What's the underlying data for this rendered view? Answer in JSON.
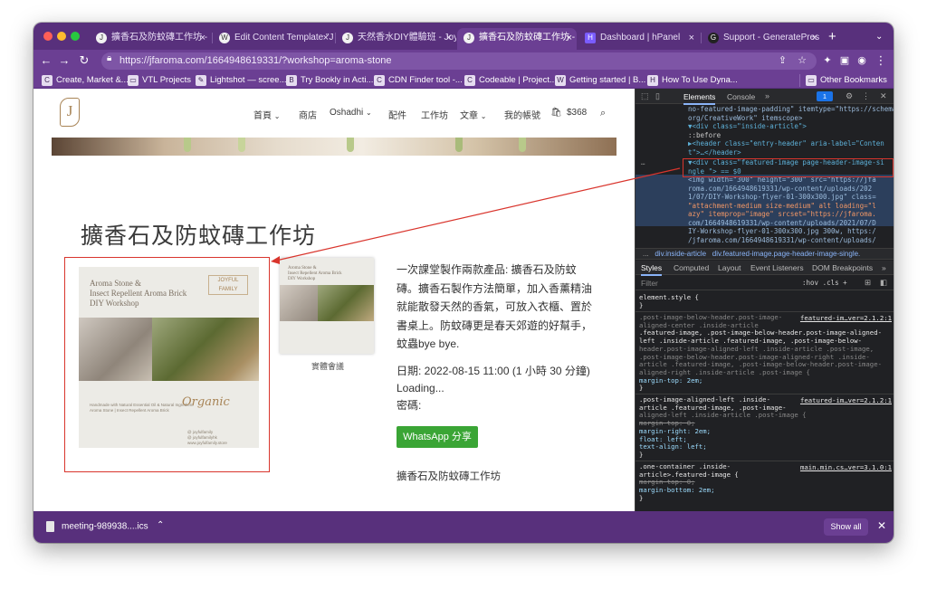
{
  "browser": {
    "tabs": [
      {
        "title": "擴香石及防蚊磚工作坊 - J",
        "icon": "joyful-icon",
        "active": false
      },
      {
        "title": "Edit Content Template \"J",
        "icon": "wordpress-icon",
        "active": false
      },
      {
        "title": "天然香水DIY體驗班 - Joy",
        "icon": "joyful-icon",
        "active": false
      },
      {
        "title": "擴香石及防蚊磚工作坊 - J",
        "icon": "joyful-icon",
        "active": true
      },
      {
        "title": "Dashboard | hPanel",
        "icon": "hostinger-icon",
        "active": false
      },
      {
        "title": "Support - GeneratePres",
        "icon": "generatepress-icon",
        "active": false
      }
    ],
    "url": "https://jfaroma.com/1664948619331/?workshop=aroma-stone",
    "bookmarks": [
      "Create, Market &...",
      "VTL Projects",
      "Lightshot — scree...",
      "Try Bookly in Acti...",
      "CDN Finder tool -...",
      "Codeable | Project...",
      "Getting started | B...",
      "How To Use Dyna..."
    ],
    "other_bookmarks": "Other Bookmarks",
    "colors": {
      "frame": "#58307c",
      "toolbar": "#6b3f93"
    }
  },
  "site": {
    "nav": [
      "首頁",
      "商店",
      "Oshadhi",
      "配件",
      "工作坊",
      "文章",
      "我的帳號"
    ],
    "cart_amount": "$368",
    "title": "擴香石及防蚊磚工作坊",
    "poster_title": [
      "Aroma Stone &",
      "Insect Repellent Aroma Brick",
      "DIY Workshop"
    ],
    "poster_brand": [
      "JOYFUL",
      "FAMILY"
    ],
    "poster_organic": "Organic",
    "poster_small": [
      "Handmade with Natural Essential Oil & Natural Ingredient",
      "Aroma Stone | Insect Repellent Aroma Brick"
    ],
    "poster_social": [
      "@ joyfulfamily",
      "@ joyfulfamilyhk",
      "www.joyfulfamily.store"
    ],
    "thumb_title": [
      "Aroma Stone &",
      "Insect Repellent Aroma Brick",
      "DIY Workshop"
    ],
    "thumb_caption": "實體會議",
    "description": "一次課堂製作兩款產品: 擴香石及防蚊磚。擴香石製作方法簡單，加入香薰精油就能散發天然的香氣，可放入衣櫃、置於書桌上。防蚊磚更是春天郊遊的好幫手，蚊蟲bye bye.",
    "date_line": "日期: 2022-08-15 11:00 (1 小時 30 分鐘)",
    "loading": "Loading...",
    "password": "密碼:",
    "whatsapp_label": "WhatsApp 分享",
    "footer_title": "擴香石及防蚊磚工作坊",
    "whatsapp_color": "#3aa535",
    "annotation_color": "#d9352d"
  },
  "devtools": {
    "tabs": [
      "Elements",
      "Console"
    ],
    "badge": "1",
    "code_lines": [
      "no-featured-image-padding\" itemtype=\"https://schema.",
      "org/CreativeWork\" itemscope>",
      "▼<div class=\"inside-article\">",
      "  ::before",
      "  ▶<header class=\"entry-header\" aria-label=\"Conten",
      "  t\">…</header>",
      "  ▼<div class=\"featured-image  page-header-image-si",
      "  ngle \"> == $0",
      "    <img width=\"300\" height=\"300\" src=\"https://jfa",
      "    roma.com/1664948619331/wp-content/uploads/202",
      "    1/07/DIY-Workshop-flyer-01-300x300.jpg\" class=",
      "    \"attachment-medium size-medium\" alt loading=\"l",
      "    azy\" itemprop=\"image\" srcset=\"https://jfaroma.",
      "    com/1664948619331/wp-content/uploads/2021/07/D",
      "    IY-Workshop-flyer-01-300x300.jpg 300w, https:/",
      "    /jfaroma.com/1664948619331/wp-content/uploads/"
    ],
    "breadcrumbs": [
      "...",
      "div.inside-article",
      "div.featured-image.page-header-image-single."
    ],
    "style_tabs": [
      "Styles",
      "Computed",
      "Layout",
      "Event Listeners",
      "DOM Breakpoints"
    ],
    "filter_placeholder": "Filter",
    "filter_tools": ":hov  .cls  +",
    "styles": [
      {
        "lines": [
          "element.style {",
          "}"
        ],
        "link": ""
      },
      {
        "lines": [
          ".post-image-below-header.post-image-",
          "aligned-center .inside-article",
          ".featured-image, .post-image-below-header.post-image-aligned-",
          "left .inside-article .featured-image, .post-image-below-",
          "header.post-image-aligned-left .inside-article .post-image,",
          ".post-image-below-header.post-image-aligned-right .inside-",
          "article .featured-image, .post-image-below-header.post-image-",
          "aligned-right .inside-article .post-image {",
          "  margin-top: 2em;",
          "}"
        ],
        "link": "featured-im…ver=2.1.2:1"
      },
      {
        "lines": [
          ".post-image-aligned-left .inside-",
          "article .featured-image, .post-image-",
          "aligned-left .inside-article .post-image {",
          "  margin-top: 0;",
          "  margin-right: 2em;",
          "  float: left;",
          "  text-align: left;",
          "}"
        ],
        "link": "featured-im…ver=2.1.2:1"
      },
      {
        "lines": [
          ".one-container .inside-",
          "article>.featured-image {",
          "  margin-top: 0;",
          "  margin-bottom: 2em;",
          "}"
        ],
        "link": "main.min.cs…ver=3.1.0:1"
      }
    ]
  },
  "download": {
    "file": "meeting-989938....ics",
    "show_all": "Show all"
  }
}
